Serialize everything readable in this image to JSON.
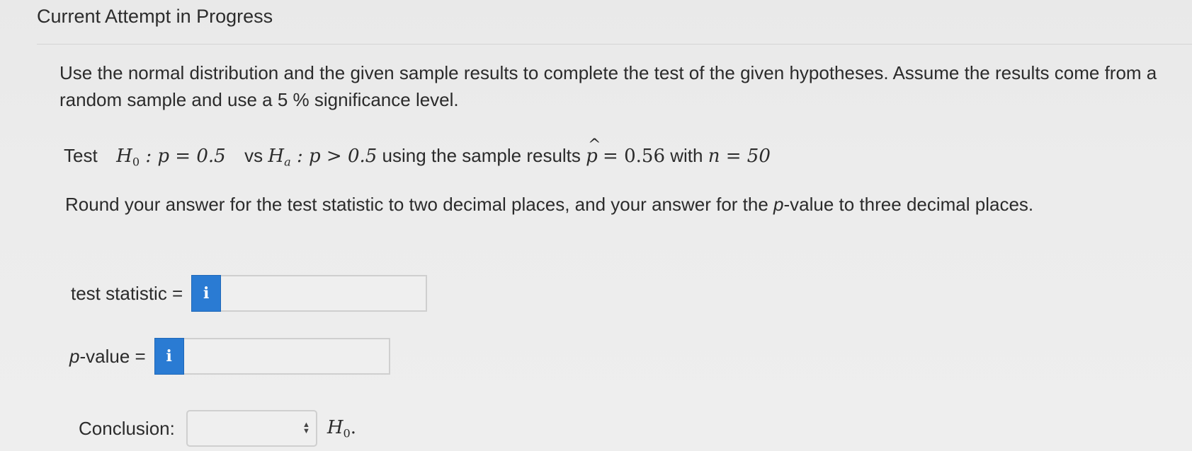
{
  "header": {
    "title": "Current Attempt in Progress"
  },
  "question": {
    "instructions": "Use the normal distribution and the given sample results to complete the test of the given hypotheses. Assume the results come from a random sample and use a 5 % significance level.",
    "hypothesis": {
      "lead": "Test",
      "null_label": "H",
      "null_sub": "0",
      "null_expr": ": p = 0.5",
      "vs": "vs",
      "alt_label": "H",
      "alt_sub": "a",
      "alt_expr": ": p > 0.5",
      "middle": "using the sample results",
      "phat_symbol": "p",
      "phat_hat": "^",
      "phat_value": "= 0.56",
      "with": "with",
      "n_expr": "n = 50"
    },
    "rounding_instructions_pre": "Round your answer for the test statistic to two decimal places, and your answer for the ",
    "rounding_instructions_p": "p",
    "rounding_instructions_post": "-value to three decimal places."
  },
  "fields": {
    "test_statistic": {
      "label": "test statistic =",
      "info_icon": "i",
      "value": "",
      "placeholder": ""
    },
    "p_value": {
      "label_p": "p",
      "label_rest": "-value =",
      "info_icon": "i",
      "value": "",
      "placeholder": ""
    },
    "conclusion": {
      "label": "Conclusion:",
      "selected": "",
      "suffix_symbol": "H",
      "suffix_sub": "0",
      "suffix_end": "."
    }
  },
  "colors": {
    "info_button": "#2a7bd3",
    "background": "#ececec"
  },
  "icons": {
    "info": "info-icon",
    "select_arrows": "updown-arrows-icon"
  }
}
